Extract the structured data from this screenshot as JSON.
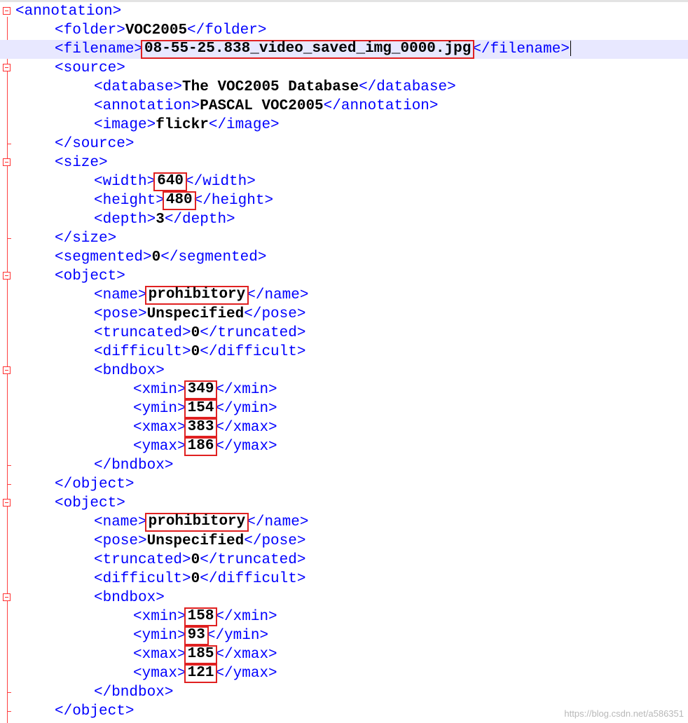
{
  "editor": {
    "lines": [
      "<annotation>",
      "<folder>",
      "VOC2005",
      "</folder>",
      "<filename>",
      "08-55-25.838_video_saved_img_0000.jpg",
      "</filename>",
      "<source>",
      "<database>",
      "The VOC2005 Database",
      "</database>",
      "<annotation>",
      "PASCAL VOC2005",
      "</annotation>",
      "<image>",
      "flickr",
      "</image>",
      "</source>",
      "<size>",
      "<width>",
      "640",
      "</width>",
      "<height>",
      "480",
      "</height>",
      "<depth>",
      "3",
      "</depth>",
      "</size>",
      "<segmented>",
      "0",
      "</segmented>",
      "<object>",
      "<name>",
      "prohibitory",
      "</name>",
      "<pose>",
      "Unspecified",
      "</pose>",
      "<truncated>",
      "0",
      "</truncated>",
      "<difficult>",
      "0",
      "</difficult>",
      "<bndbox>",
      "<xmin>",
      "349",
      "</xmin>",
      "<ymin>",
      "154",
      "</ymin>",
      "<xmax>",
      "383",
      "</xmax>",
      "<ymax>",
      "186",
      "</ymax>",
      "</bndbox>",
      "</object>",
      "<object>",
      "<name>",
      "prohibitory",
      "</name>",
      "<pose>",
      "Unspecified",
      "</pose>",
      "<truncated>",
      "0",
      "</truncated>",
      "<difficult>",
      "0",
      "</difficult>",
      "<bndbox>",
      "<xmin>",
      "158",
      "</xmin>",
      "<ymin>",
      "93",
      "</ymin>",
      "<xmax>",
      "185",
      "</xmax>",
      "<ymax>",
      "121",
      "</ymax>",
      "</bndbox>",
      "</object>"
    ]
  },
  "watermark": "https://blog.csdn.net/a586351",
  "colors": {
    "tag": "#0000ff",
    "value": "#000000",
    "highlight_box": "#e02020",
    "fold_marker": "#ff3030",
    "current_line": "#e8e8ff"
  },
  "icons": {
    "fold": "fold-minus-icon"
  }
}
